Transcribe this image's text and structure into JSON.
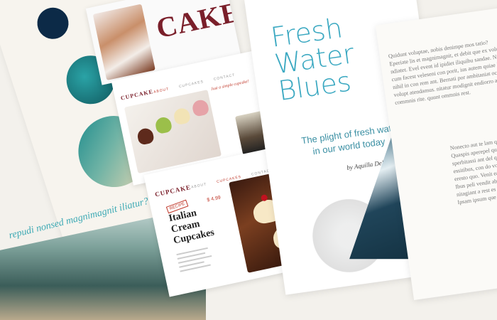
{
  "left_card": {
    "colors": {
      "dark_navy": "#0c2a47",
      "teal": "#1b7f86",
      "beige": "#d8c9a5"
    },
    "italic_line_1": "repudi nonsed magnimagnit iliatur?"
  },
  "cupcake_top": {
    "logo": "CAKE",
    "logo_prefix": "C"
  },
  "cupcake_mid": {
    "logo": "CUPCAKE",
    "nav": [
      "ABOUT",
      "CUPCAKES",
      "CONTACT"
    ],
    "heading": "Just a simple cupcake!"
  },
  "cupcake_low": {
    "logo": "CUPCAKE",
    "nav": [
      "ABOUT",
      "CUPCAKES",
      "CONTACT"
    ],
    "stamp": "RECIPE",
    "price": "$ 4.99",
    "title_1": "Italian",
    "title_2": "Cream",
    "title_3": "Cupcakes"
  },
  "poster": {
    "title_1": "Fresh",
    "title_2": "Water",
    "title_3": "Blues",
    "subtitle_1": "The plight of fresh water",
    "subtitle_2": "in our world today",
    "byline": "by Aquilla DeMer"
  },
  "text_page": {
    "body_a": "Quidunt voluptae, nobis denimpe mos tatio? Eperiate lis et magnimagnit, et debit que ex volupta ndiatet. Evel event id ipidiet iliquibu sandae. Nas cum facest veleseni con porit, ius autem quiae la nihil in con rem ant. Bernati por ambitaniat occae ex volupt atendamus. nitatur modignit endiorro aute commnis rite. quunt ommnis rest.",
    "body_b": "Nonecto aut te lam quae. Quaspis aperepel que sperbitassi ant del que aperiat essitibus, con do volorep eresto quo. Venit eatecepudi. Ibus peli vendit ab noncs ati. nitagiant a rest es tempel bunt. Ipsam ipsum que laborios."
  }
}
